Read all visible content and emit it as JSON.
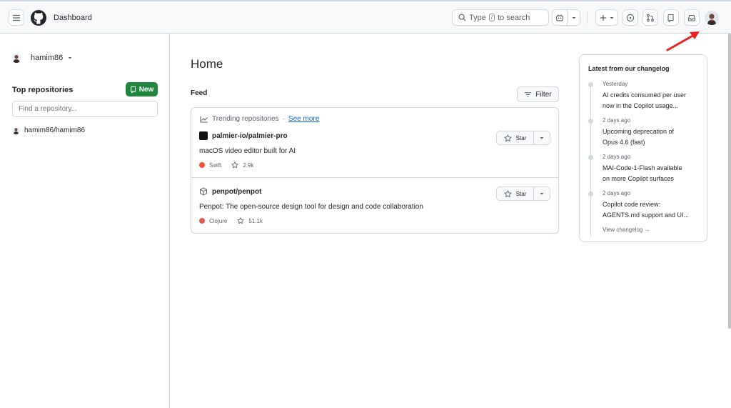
{
  "header": {
    "title": "Dashboard",
    "search": {
      "prefix": "Type",
      "key": "/",
      "suffix": "to search"
    }
  },
  "sidebar": {
    "username": "hamim86",
    "top_repos_label": "Top repositories",
    "new_label": "New",
    "find_placeholder": "Find a repository...",
    "repos": [
      "hamim86/hamim86"
    ]
  },
  "main": {
    "title": "Home",
    "feed_label": "Feed",
    "filter_label": "Filter",
    "trending_label": "Trending repositories",
    "separator": "·",
    "see_more": "See more",
    "star_label": "Star",
    "repos": [
      {
        "name": "palmier-io/palmier-pro",
        "description": "macOS video editor built for AI",
        "language": "Swift",
        "language_color": "#f05138",
        "stars": "2.9k"
      },
      {
        "name": "penpot/penpot",
        "description": "Penpot: The open-source design tool for design and code collaboration",
        "language": "Clojure",
        "language_color": "#db5855",
        "stars": "51.1k"
      }
    ]
  },
  "changelog": {
    "title": "Latest from our changelog",
    "items": [
      {
        "date": "Yesterday",
        "line1": "AI credits consumed per user",
        "line2": "now in the Copilot usage..."
      },
      {
        "date": "2 days ago",
        "line1": "Upcoming deprecation of",
        "line2": "Opus 4.6 (fast)"
      },
      {
        "date": "2 days ago",
        "line1": "MAI-Code-1-Flash available",
        "line2": "on more Copilot surfaces"
      },
      {
        "date": "2 days ago",
        "line1": "Copilot code review:",
        "line2": "AGENTS.md support and UI..."
      }
    ],
    "view_label": "View changelog →"
  },
  "colors": {
    "accent": "#0969da",
    "new_button": "#1f883d",
    "annotation_arrow": "#e8201e"
  }
}
